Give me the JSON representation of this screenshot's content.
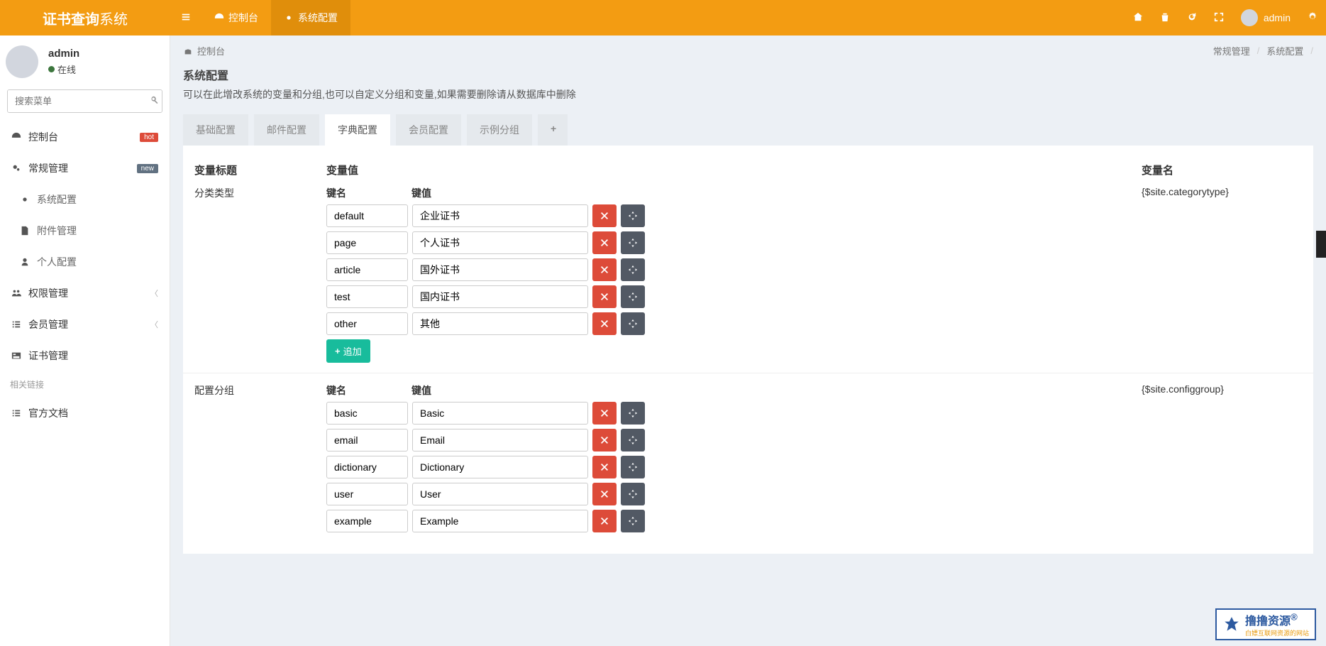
{
  "brand": {
    "bold": "证书查询",
    "light": "系统"
  },
  "topnav": [
    {
      "label": "控制台",
      "active": false
    },
    {
      "label": "系统配置",
      "active": true
    }
  ],
  "topuser": "admin",
  "user": {
    "name": "admin",
    "status": "在线"
  },
  "search": {
    "placeholder": "搜索菜单"
  },
  "menu": [
    {
      "label": "控制台",
      "icon": "dashboard",
      "badge": "hot",
      "badgeClass": "badge-hot"
    },
    {
      "label": "常规管理",
      "icon": "cogs",
      "badge": "new",
      "badgeClass": "badge-new"
    },
    {
      "label": "系统配置",
      "icon": "cog",
      "sub": true
    },
    {
      "label": "附件管理",
      "icon": "file",
      "sub": true
    },
    {
      "label": "个人配置",
      "icon": "user",
      "sub": true
    },
    {
      "label": "权限管理",
      "icon": "users",
      "chev": true
    },
    {
      "label": "会员管理",
      "icon": "list",
      "chev": true
    },
    {
      "label": "证书管理",
      "icon": "card"
    }
  ],
  "sectionLabel": "相关链接",
  "menu2": [
    {
      "label": "官方文档",
      "icon": "list"
    }
  ],
  "breadcrumb": {
    "home": "控制台",
    "path": [
      "常规管理",
      "系统配置"
    ]
  },
  "panel": {
    "title": "系统配置",
    "desc": "可以在此增改系统的变量和分组,也可以自定义分组和变量,如果需要删除请从数据库中删除"
  },
  "tabs": [
    "基础配置",
    "邮件配置",
    "字典配置",
    "会员配置",
    "示例分组"
  ],
  "activeTab": 2,
  "headers": {
    "title": "变量标题",
    "value": "变量值",
    "name": "变量名",
    "kname": "键名",
    "kval": "键值"
  },
  "addLabel": "追加",
  "groups": [
    {
      "title": "分类类型",
      "name": "{$site.categorytype}",
      "rows": [
        {
          "k": "default",
          "v": "企业证书"
        },
        {
          "k": "page",
          "v": "个人证书"
        },
        {
          "k": "article",
          "v": "国外证书"
        },
        {
          "k": "test",
          "v": "国内证书"
        },
        {
          "k": "other",
          "v": "其他"
        }
      ]
    },
    {
      "title": "配置分组",
      "name": "{$site.configgroup}",
      "rows": [
        {
          "k": "basic",
          "v": "Basic"
        },
        {
          "k": "email",
          "v": "Email"
        },
        {
          "k": "dictionary",
          "v": "Dictionary"
        },
        {
          "k": "user",
          "v": "User"
        },
        {
          "k": "example",
          "v": "Example"
        }
      ]
    }
  ],
  "watermark": {
    "main": "撸撸资源",
    "sub": "白嫖互联网资源的网站"
  }
}
